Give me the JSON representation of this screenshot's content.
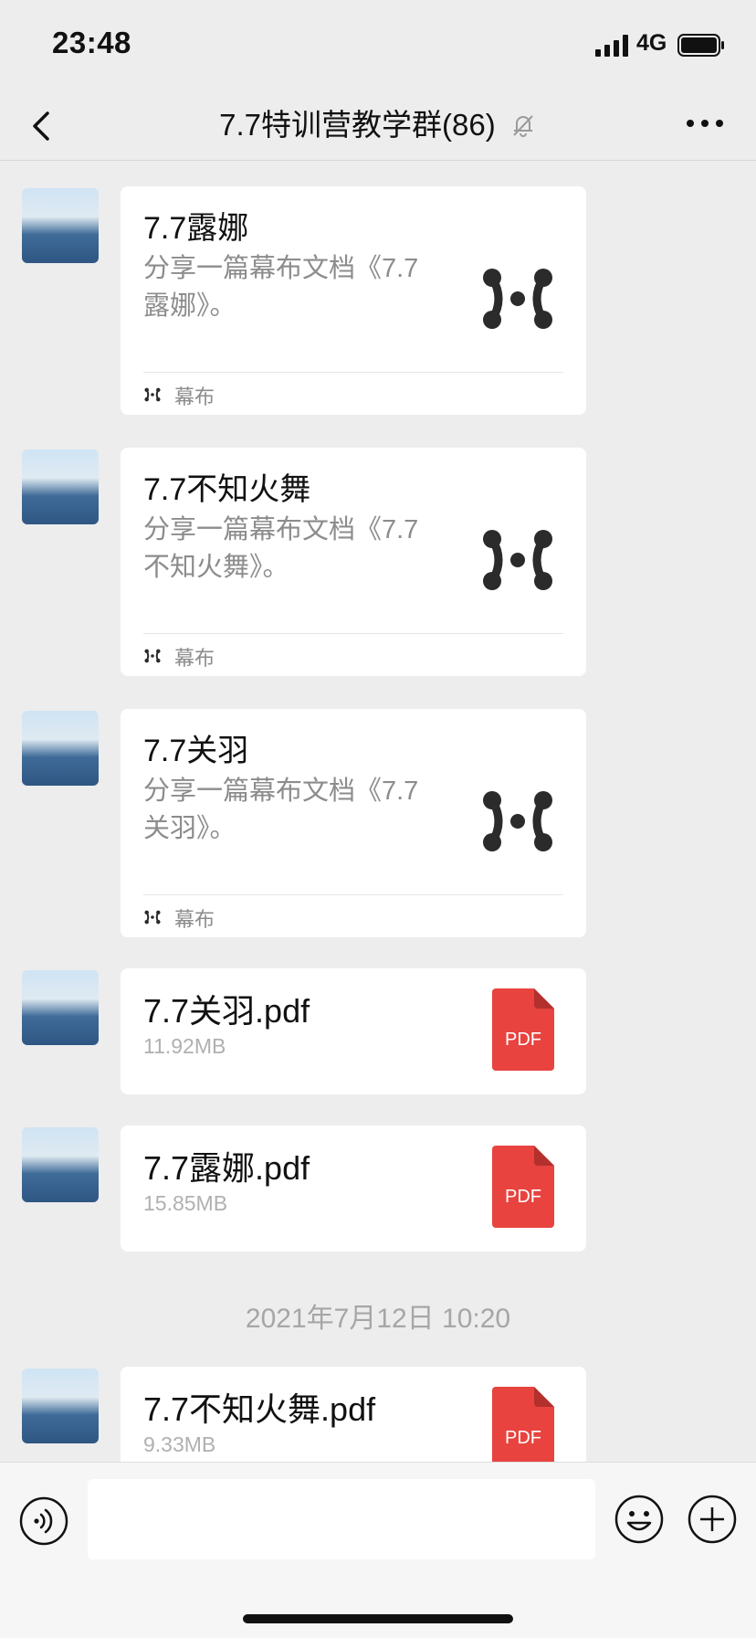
{
  "status_bar": {
    "time": "23:48",
    "network": "4G"
  },
  "nav": {
    "title": "7.7特训营教学群(86)"
  },
  "messages": [
    {
      "type": "card",
      "title": "7.7露娜",
      "desc": "分享一篇幕布文档《7.7露娜》。",
      "source": "幕布"
    },
    {
      "type": "card",
      "title": "7.7不知火舞",
      "desc": "分享一篇幕布文档《7.7不知火舞》。",
      "source": "幕布"
    },
    {
      "type": "card",
      "title": "7.7关羽",
      "desc": "分享一篇幕布文档《7.7关羽》。",
      "source": "幕布"
    },
    {
      "type": "file",
      "name": "7.7关羽.pdf",
      "size": "11.92MB",
      "icon_label": "PDF"
    },
    {
      "type": "file",
      "name": "7.7露娜.pdf",
      "size": "15.85MB",
      "icon_label": "PDF"
    },
    {
      "type": "file",
      "name": "7.7不知火舞.pdf",
      "size": "9.33MB",
      "icon_label": "PDF"
    }
  ],
  "timestamp": "2021年7月12日 10:20",
  "colors": {
    "pdf_red": "#e8433f",
    "background": "#ededed",
    "bubble": "#ffffff"
  },
  "icons": [
    "back-arrow-icon",
    "mute-bell-icon",
    "more-icon",
    "mubu-logo-icon",
    "pdf-file-icon",
    "voice-icon",
    "emoji-icon",
    "plus-icon"
  ]
}
